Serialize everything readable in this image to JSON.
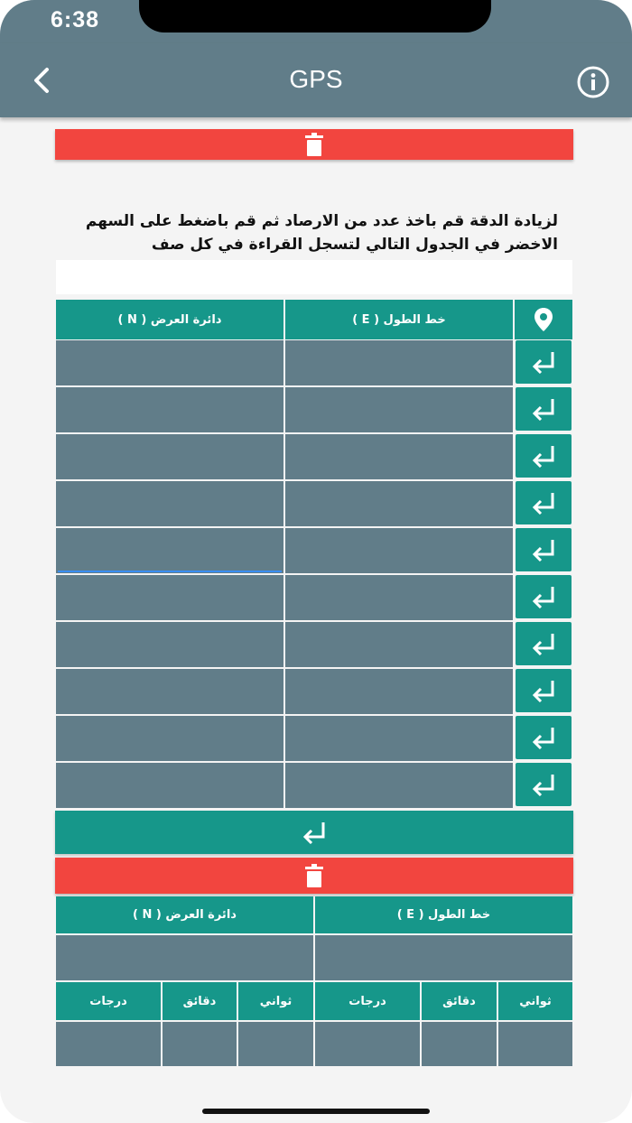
{
  "status": {
    "time": "6:38"
  },
  "appbar": {
    "title": "GPS",
    "back_icon": "chevron-left-icon",
    "info_icon": "info-circle-icon"
  },
  "instructions": "لزيادة الدقة  قم باخذ عدد من الارصاد ثم قم باضغط على السهم الاخضر في الجدول التالي  لتسجل القراءة في كل صف",
  "readings_table": {
    "col_latitude": "دائرة العرض ( N )",
    "col_longitude": "خط الطول ( E )",
    "location_icon": "location-pin-icon",
    "row_count": 10,
    "row_button_icon": "enter-arrow-icon"
  },
  "result_table": {
    "col_latitude": "دائرة العرض ( N )",
    "col_longitude": "خط الطول ( E )",
    "sub_headers_lat": [
      "درجات",
      "دقائق",
      "ثواني"
    ],
    "sub_headers_lon": [
      "درجات",
      "دقائق",
      "ثواني"
    ]
  },
  "colors": {
    "header": "#617d89",
    "teal": "#16978a",
    "delete": "#f2453f",
    "cell": "#617d89"
  }
}
